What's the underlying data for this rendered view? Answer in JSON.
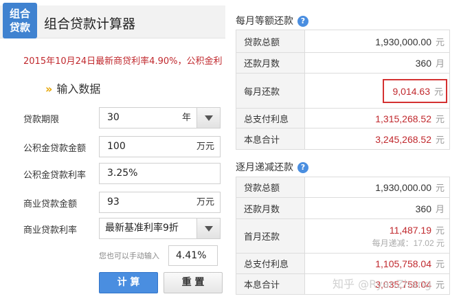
{
  "header": {
    "logo_line1": "组合",
    "logo_line2": "贷款",
    "title": "组合贷款计算器"
  },
  "notice": "2015年10月24日最新商贷利率4.90%，公积金利",
  "section_title": "输入数据",
  "section_arrow": "»",
  "form": {
    "term": {
      "label": "贷款期限",
      "value": "30",
      "unit": "年"
    },
    "fund_amount": {
      "label": "公积金贷款金额",
      "value": "100",
      "unit": "万元"
    },
    "fund_rate": {
      "label": "公积金贷款利率",
      "value": "3.25%"
    },
    "comm_amount": {
      "label": "商业贷款金额",
      "value": "93",
      "unit": "万元"
    },
    "comm_rate": {
      "label": "商业贷款利率",
      "value": "最新基准利率9折"
    },
    "manual_hint": "您也可以手动输入",
    "manual_value": "4.41%",
    "calc_label": "计 算",
    "reset_label": "重 置"
  },
  "equal_payment": {
    "title": "每月等额还款",
    "help": "?",
    "rows": [
      {
        "label": "贷款总额",
        "value": "1,930,000.00",
        "unit": "元"
      },
      {
        "label": "还款月数",
        "value": "360",
        "unit": "月"
      },
      {
        "label": "每月还款",
        "value": "9,014.63",
        "unit": "元"
      },
      {
        "label": "总支付利息",
        "value": "1,315,268.52",
        "unit": "元"
      },
      {
        "label": "本息合计",
        "value": "3,245,268.52",
        "unit": "元"
      }
    ]
  },
  "decreasing": {
    "title": "逐月递减还款",
    "help": "?",
    "rows": [
      {
        "label": "贷款总额",
        "value": "1,930,000.00",
        "unit": "元"
      },
      {
        "label": "还款月数",
        "value": "360",
        "unit": "月"
      },
      {
        "label": "首月还款",
        "value": "11,487.19",
        "unit": "元",
        "sub": "每月递减：17.02 元"
      },
      {
        "label": "总支付利息",
        "value": "1,105,758.04",
        "unit": "元"
      },
      {
        "label": "本息合计",
        "value": "3,035,758.04",
        "unit": "元"
      }
    ]
  },
  "watermark": "知乎 @RyanZhang",
  "colors": {
    "accent": "#4a8ee0",
    "highlight": "#c0282d"
  }
}
